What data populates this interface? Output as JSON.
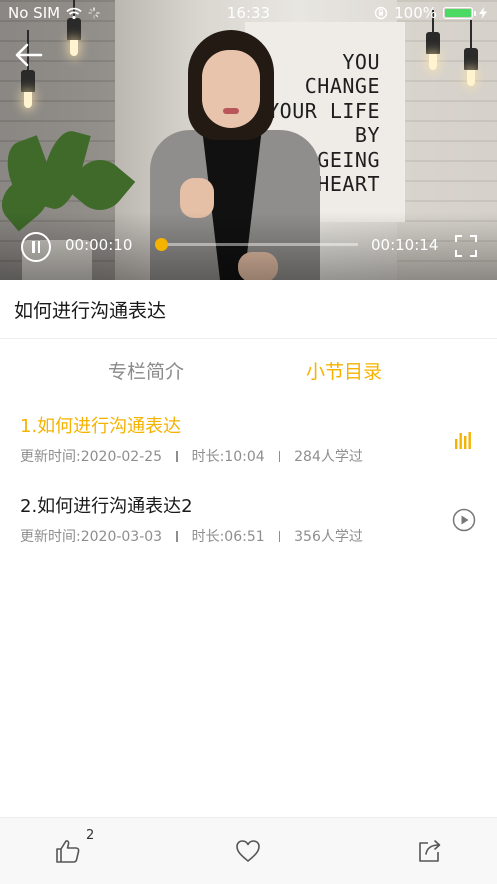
{
  "status_bar": {
    "carrier": "No SIM",
    "time": "16:33",
    "battery_text": "100%",
    "battery_color": "#4cd964"
  },
  "video": {
    "poster_text": "YOU\nCHANGE\nYOUR LIFE\nBY\nANGEING\nHEART",
    "current_time": "00:00:10",
    "total_time": "00:10:14",
    "progress_fraction": 0.016,
    "accent_color": "#f5b300",
    "icons": {
      "back": "arrow-left-icon",
      "play_state": "pause-icon",
      "fullscreen": "fullscreen-icon"
    }
  },
  "lesson_title": "如何进行沟通表达",
  "tabs": [
    {
      "label": "专栏简介",
      "active": false
    },
    {
      "label": "小节目录",
      "active": true
    }
  ],
  "sections": [
    {
      "title": "1.如何进行沟通表达",
      "updated": "更新时间:2020-02-25",
      "duration": "时长:10:04",
      "learners": "284人学过",
      "playing": true,
      "icon": "audio-bars-icon"
    },
    {
      "title": "2.如何进行沟通表达2",
      "updated": "更新时间:2020-03-03",
      "duration": "时长:06:51",
      "learners": "356人学过",
      "playing": false,
      "icon": "play-circle-icon"
    }
  ],
  "bottom_bar": {
    "like_count": "2",
    "icons": [
      "thumbs-up-icon",
      "heart-icon",
      "share-icon"
    ]
  }
}
